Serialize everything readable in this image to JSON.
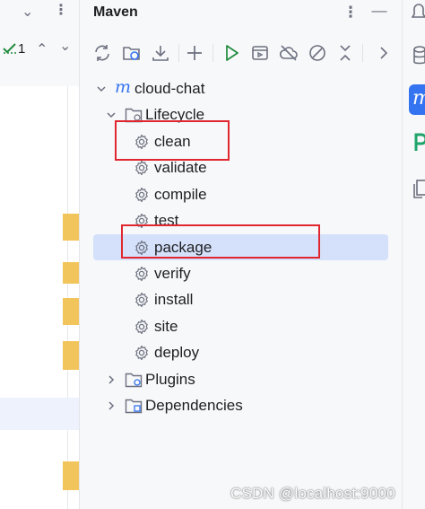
{
  "left_gutter": {
    "inspection_count": "1"
  },
  "panel": {
    "title": "Maven"
  },
  "toolbar": {
    "icons": [
      "reload-icon",
      "reimport-folder-icon",
      "download-icon",
      "add-icon",
      "run-icon",
      "execute-goal-icon",
      "offline-icon",
      "skip-tests-icon",
      "collapse-icon",
      "more-icon"
    ]
  },
  "tree": {
    "project": {
      "label": "cloud-chat",
      "prefix": "m"
    },
    "lifecycle": {
      "label": "Lifecycle",
      "goals": [
        "clean",
        "validate",
        "compile",
        "test",
        "package",
        "verify",
        "install",
        "site",
        "deploy"
      ],
      "selected": "package"
    },
    "plugins": {
      "label": "Plugins"
    },
    "dependencies": {
      "label": "Dependencies"
    }
  },
  "highlights": [
    "clean",
    "package"
  ],
  "colors": {
    "accent": "#3574f0",
    "selection": "#d5e1fa",
    "highlight_box": "#e0262f",
    "run_green": "#208a3c",
    "gutter_marks": "#f2c55c"
  },
  "watermark": "CSDN @localhost:9000"
}
